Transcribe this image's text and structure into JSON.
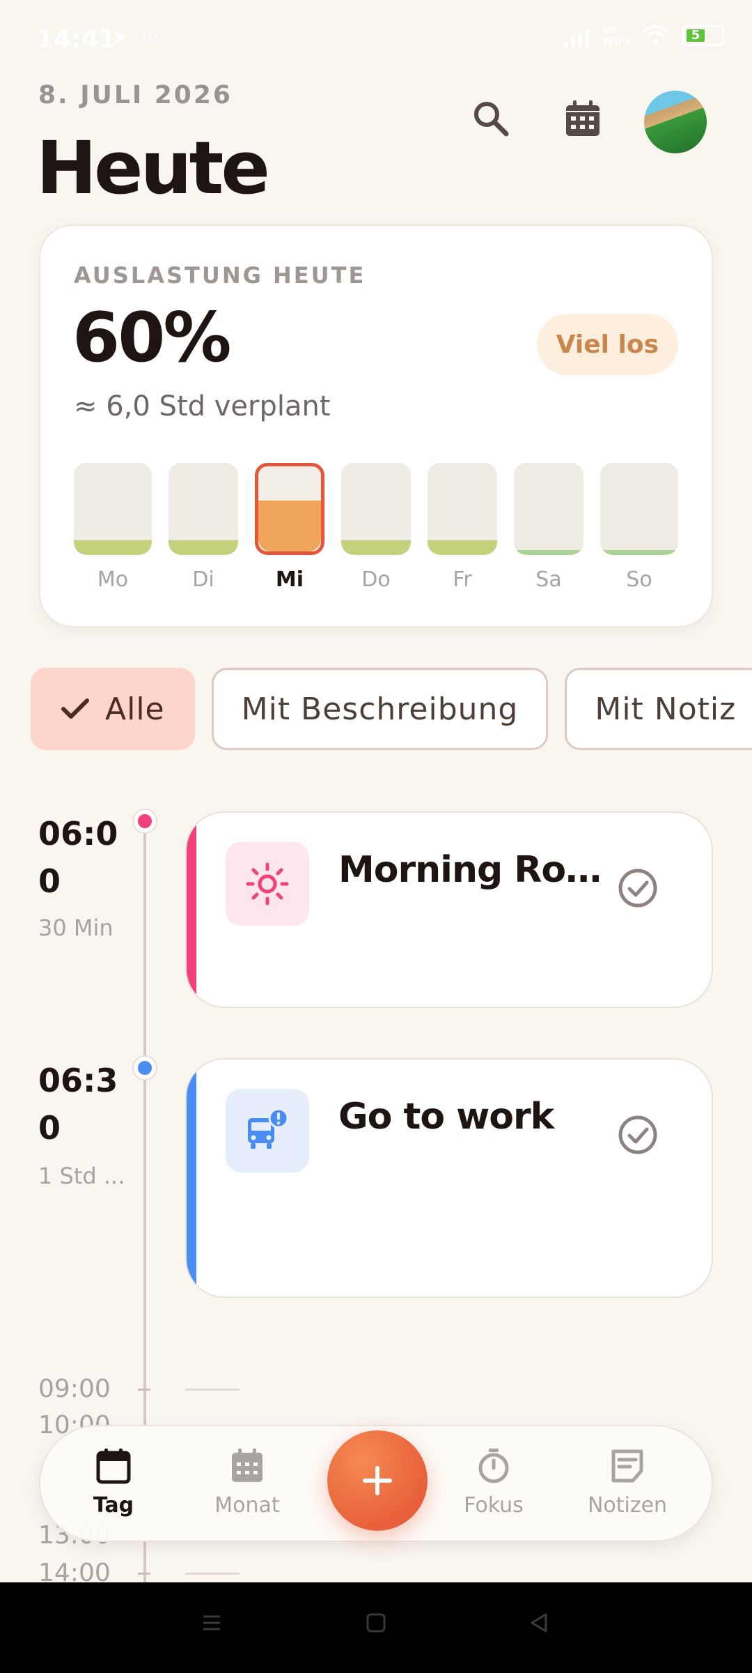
{
  "status_bar": {
    "time": "14:41",
    "battery": "5"
  },
  "header": {
    "date": "8. JULI 2026",
    "title": "Heute"
  },
  "load_card": {
    "label": "AUSLASTUNG HEUTE",
    "percent": "60%",
    "planned": "≈ 6,0 Std verplant",
    "badge": "Viel los",
    "days": [
      {
        "label": "Mo",
        "level": 0.16,
        "color": "#c5d07a"
      },
      {
        "label": "Di",
        "level": 0.16,
        "color": "#c5d07a"
      },
      {
        "label": "Mi",
        "level": 0.6,
        "color": "#f0a65a",
        "selected": true
      },
      {
        "label": "Do",
        "level": 0.16,
        "color": "#c5d07a"
      },
      {
        "label": "Fr",
        "level": 0.16,
        "color": "#c5d07a"
      },
      {
        "label": "Sa",
        "level": 0.05,
        "color": "#a9d496"
      },
      {
        "label": "So",
        "level": 0.05,
        "color": "#a9d496"
      }
    ]
  },
  "filters": [
    {
      "label": "Alle",
      "active": true
    },
    {
      "label": "Mit Beschreibung"
    },
    {
      "label": "Mit Notiz"
    }
  ],
  "events": [
    {
      "time": "06:00",
      "time_line1": "06:0",
      "time_line2": "0",
      "duration": "30 Min",
      "title": "Morning Rout...",
      "icon": "sun-icon",
      "color": "#f0417a",
      "icon_bg": "#fde6ec"
    },
    {
      "time": "06:30",
      "time_line1": "06:3",
      "time_line2": "0",
      "duration": "1 Std ...",
      "title": "Go to work",
      "icon": "bus-alert-icon",
      "color": "#4a8df2",
      "icon_bg": "#e6eefc"
    }
  ],
  "hours": [
    "09:00",
    "10:00",
    "13:00",
    "14:00"
  ],
  "bottom_nav": [
    {
      "label": "Tag",
      "icon": "calendar-day-icon",
      "active": true
    },
    {
      "label": "Monat",
      "icon": "calendar-month-icon"
    },
    {
      "label": "Fokus",
      "icon": "timer-icon"
    },
    {
      "label": "Notizen",
      "icon": "notes-icon"
    }
  ],
  "fab": {
    "icon": "plus-icon"
  }
}
